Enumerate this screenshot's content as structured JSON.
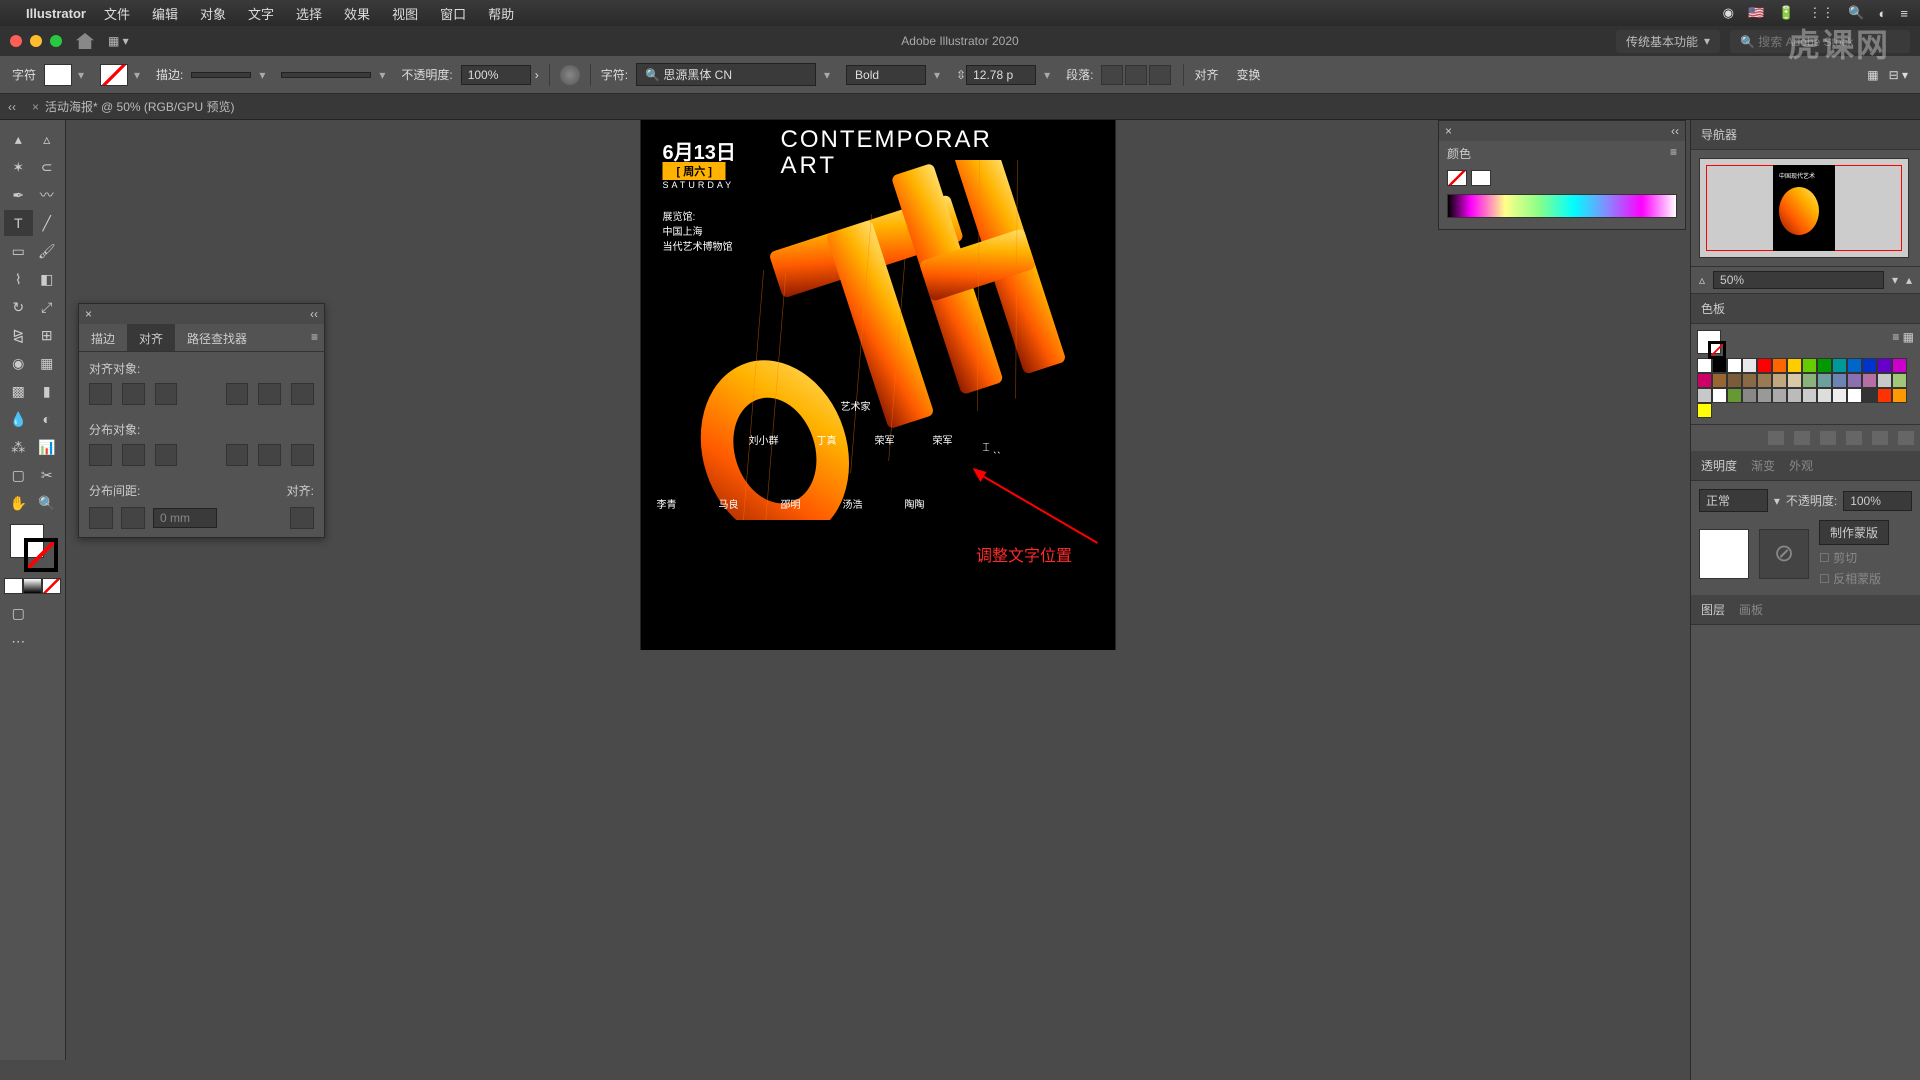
{
  "menubar": {
    "app": "Illustrator",
    "items": [
      "文件",
      "编辑",
      "对象",
      "文字",
      "选择",
      "效果",
      "视图",
      "窗口",
      "帮助"
    ]
  },
  "titlebar": {
    "title": "Adobe Illustrator 2020",
    "workspace": "传统基本功能",
    "search_placeholder": "搜索 Adobe Stock"
  },
  "control": {
    "char_label": "字符",
    "stroke_label": "描边:",
    "opacity_label": "不透明度:",
    "opacity_val": "100%",
    "font_label": "字符:",
    "font_name": "思源黑体 CN",
    "font_weight": "Bold",
    "font_size": "12.78 p",
    "para_label": "段落:",
    "align_label": "对齐",
    "transform_label": "变换"
  },
  "tab": {
    "name": "活动海报* @ 50% (RGB/GPU 预览)"
  },
  "align_panel": {
    "tabs": [
      "描边",
      "对齐",
      "路径查找器"
    ],
    "align_objects": "对齐对象:",
    "distribute_objects": "分布对象:",
    "distribute_spacing": "分布间距:",
    "align_to": "对齐:",
    "spacing_val": "0 mm"
  },
  "color_panel": {
    "title": "颜色"
  },
  "artboard": {
    "date": "6月13日",
    "day": "[ 周六 ]",
    "sat": "SATURDAY",
    "ca1": "CONTEMPORAR",
    "ca2": "ART",
    "venue": [
      "展览馆:",
      "中国上海",
      "当代艺术博物馆"
    ],
    "artist_label": "艺术家",
    "row1": [
      "刘小群",
      "丁真",
      "荣军",
      "荣军"
    ],
    "row2": [
      "李青",
      "马良",
      "邵明",
      "汤浩",
      "陶陶"
    ]
  },
  "annotation": "调整文字位置",
  "nav": {
    "title": "导航器",
    "zoom": "50%"
  },
  "swatch_panel": {
    "title": "色板"
  },
  "transparency": {
    "tabs": [
      "透明度",
      "渐变",
      "外观"
    ],
    "mode": "正常",
    "opacity_label": "不透明度:",
    "opacity": "100%",
    "make_mask": "制作蒙版",
    "clip": "剪切",
    "invert": "反相蒙版"
  },
  "layers": {
    "tabs": [
      "图层",
      "画板"
    ]
  },
  "swatch_colors": [
    "#ffffff",
    "#000000",
    "#ffffff",
    "#e8e8e8",
    "#ff0000",
    "#ff6600",
    "#ffcc00",
    "#66cc00",
    "#009900",
    "#009999",
    "#0066cc",
    "#0033cc",
    "#6600cc",
    "#cc00cc",
    "#cc0066",
    "#996633",
    "#7a5b3a",
    "#8a6a44",
    "#9a7a54",
    "#c0a77f",
    "#d9c8a8",
    "#89b37b",
    "#6f9e9e",
    "#6b84b5",
    "#8b6fb0",
    "#b56fa3",
    "#c8c8c8",
    "#a0c878",
    "#c8c8c8",
    "#ffffff",
    "#669933",
    "#888888",
    "#999999",
    "#aaaaaa",
    "#bbbbbb",
    "#cccccc",
    "#dddddd",
    "#eeeeee",
    "#ffffff",
    "#333333",
    "#ff3300",
    "#ff9900",
    "#ffff00"
  ],
  "watermark": "虎课网"
}
